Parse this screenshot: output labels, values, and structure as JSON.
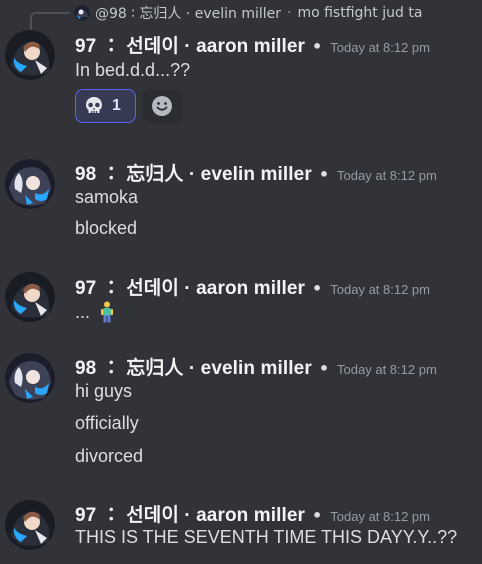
{
  "reply": {
    "username": "@98 ∶ 忘归人 · evelin miller",
    "separator": "·",
    "content": "mo fistfight jud ta"
  },
  "messages": [
    {
      "username": "97 ∶ 선데이 · aaron miller",
      "timestamp": "Today at 8:12 pm",
      "lines": [
        "In bed.d.d...??"
      ],
      "reactions": [
        {
          "emoji": "skull-emoji",
          "count": "1"
        }
      ]
    },
    {
      "username": "98 ∶ 忘归人 · evelin miller",
      "timestamp": "Today at 8:12 pm",
      "lines": [
        "samoka",
        "blocked"
      ]
    },
    {
      "username": "97 ∶ 선데이 · aaron miller",
      "timestamp": "Today at 8:12 pm",
      "lines": [
        "..."
      ]
    },
    {
      "username": "98 ∶ 忘归人 · evelin miller",
      "timestamp": "Today at 8:12 pm",
      "lines": [
        "hi guys",
        "officially",
        "divorced"
      ]
    },
    {
      "username": "97 ∶ 선데이 · aaron miller",
      "timestamp": "Today at 8:12 pm",
      "lines": [
        "THIS IS THE SEVENTH TIME THIS DAYY.Y..??"
      ]
    }
  ],
  "dot": "•",
  "icons": {
    "skull": "skull-emoji",
    "add_reaction": "smiley-icon",
    "standing_person": "person-standing-emoji"
  },
  "colors": {
    "background": "#313338",
    "reaction_active_bg": "#373a53",
    "reaction_active_border": "#5865f2",
    "timestamp": "#949ba4"
  }
}
